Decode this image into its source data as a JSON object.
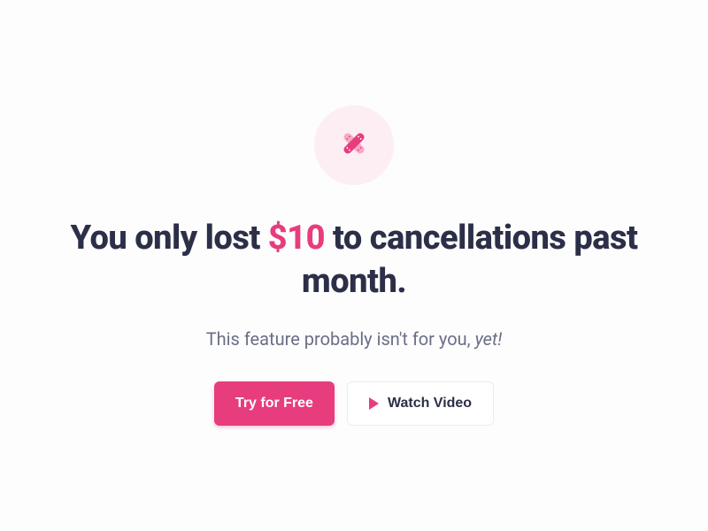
{
  "icon": "bandage-cross-icon",
  "headline": {
    "part1": "You only lost ",
    "amount": "$10",
    "part2": " to cancellations past month."
  },
  "subtext": {
    "part1": "This feature probably isn't for you, ",
    "emph": "yet!"
  },
  "buttons": {
    "primary": "Try for Free",
    "secondary": "Watch Video"
  },
  "colors": {
    "accent": "#e73c7e",
    "dark": "#2c2f48",
    "muted": "#6b6e86",
    "iconBg": "#fdeef3"
  }
}
